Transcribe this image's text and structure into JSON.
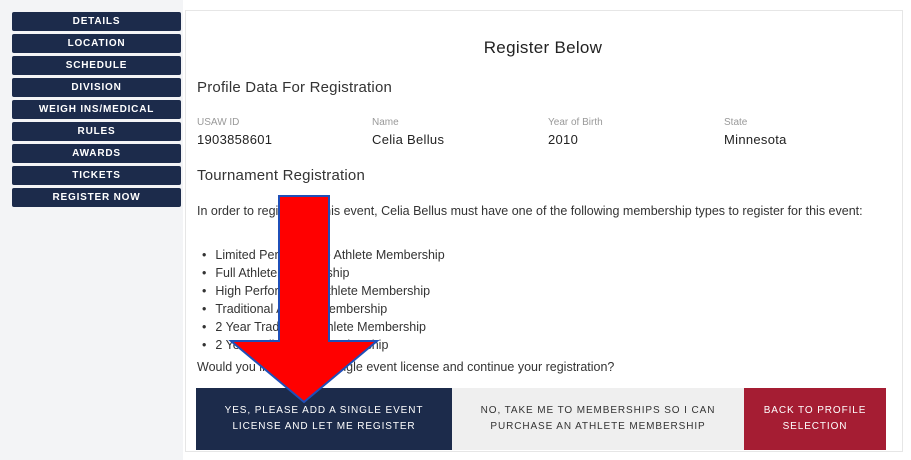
{
  "sidebar": {
    "items": [
      {
        "label": "DETAILS"
      },
      {
        "label": "LOCATION"
      },
      {
        "label": "SCHEDULE"
      },
      {
        "label": "DIVISION"
      },
      {
        "label": "WEIGH INS/MEDICAL"
      },
      {
        "label": "RULES"
      },
      {
        "label": "AWARDS"
      },
      {
        "label": "TICKETS"
      },
      {
        "label": "REGISTER NOW"
      }
    ]
  },
  "main": {
    "title": "Register Below",
    "profile_section_title": "Profile Data For Registration",
    "profile_fields": [
      {
        "label": "USAW ID",
        "value": "1903858601"
      },
      {
        "label": "Name",
        "value": "Celia Bellus"
      },
      {
        "label": "Year of Birth",
        "value": "2010"
      },
      {
        "label": "State",
        "value": "Minnesota"
      }
    ],
    "registration_section_title": "Tournament Registration",
    "intro_text": "In order to register for this event, Celia Bellus must have one of the following membership types to register for this event:",
    "memberships": [
      "Limited Performance Athlete Membership",
      "Full Athlete Membership",
      "High Performance Athlete Membership",
      "Traditional Athlete Membership",
      "2 Year Traditional Athlete Membership",
      "2 Year Full Athlete Membership"
    ],
    "question_text": "Would you like to add a single event license and continue your registration?",
    "buttons": {
      "yes_label": "YES, PLEASE ADD A SINGLE EVENT LICENSE AND LET ME REGISTER",
      "no_label": "NO, TAKE ME TO MEMBERSHIPS SO I CAN PURCHASE AN ATHLETE MEMBERSHIP",
      "back_label": "BACK TO PROFILE SELECTION"
    }
  },
  "colors": {
    "navy": "#1c2b4b",
    "crimson": "#a51d33",
    "arrow_red": "#ff0000",
    "arrow_outline": "#1f4fb8"
  },
  "annotation": {
    "icon": "down-arrow-icon"
  }
}
